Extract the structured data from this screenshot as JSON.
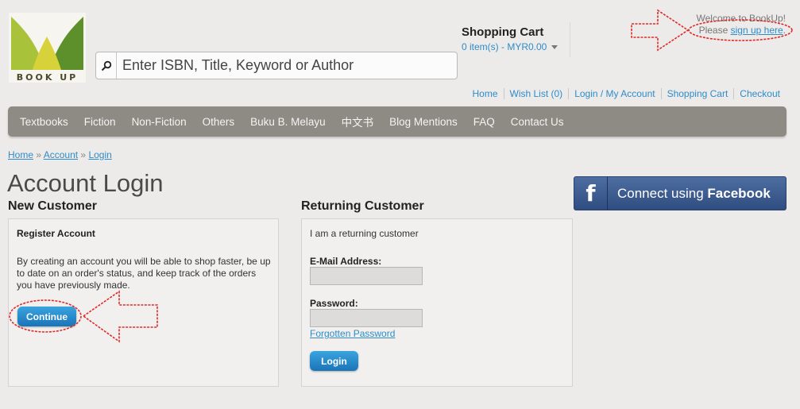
{
  "logo": {
    "text": "BOOK UP",
    "colors": {
      "leaf_left": "#a8c33a",
      "leaf_right": "#5d8f2a"
    }
  },
  "search": {
    "placeholder": "Enter ISBN, Title, Keyword or Author",
    "icon": "search-icon"
  },
  "cart": {
    "title": "Shopping Cart",
    "summary": "0 item(s) - MYR0.00"
  },
  "welcome": {
    "line1": "Welcome to BookUp!",
    "prefix": "Please",
    "link": "sign up here",
    "suffix": "."
  },
  "top_links": [
    "Home",
    "Wish List (0)",
    "Login / My Account",
    "Shopping Cart",
    "Checkout"
  ],
  "nav": [
    "Textbooks",
    "Fiction",
    "Non-Fiction",
    "Others",
    "Buku B. Melayu",
    "中文书",
    "Blog Mentions",
    "FAQ",
    "Contact Us"
  ],
  "breadcrumb": {
    "items": [
      "Home",
      "Account",
      "Login"
    ],
    "separator": "»"
  },
  "page_title": "Account Login",
  "facebook": {
    "prefix": "Connect using",
    "brand": "Facebook",
    "icon": "f"
  },
  "new_customer": {
    "heading": "New Customer",
    "subheading": "Register Account",
    "text": "By creating an account you will be able to shop faster, be up to date on an order's status, and keep track of the orders you have previously made.",
    "button": "Continue"
  },
  "returning_customer": {
    "heading": "Returning Customer",
    "intro": "I am a returning customer",
    "email_label": "E-Mail Address:",
    "email_value": "",
    "password_label": "Password:",
    "password_value": "",
    "forgot": "Forgotten Password",
    "button": "Login"
  },
  "colors": {
    "link": "#2e8cc8",
    "nav_bg": "#8e8a84",
    "button": "#1a74b8",
    "annotation": "#e02a2a",
    "facebook": "#3b5a8c"
  }
}
